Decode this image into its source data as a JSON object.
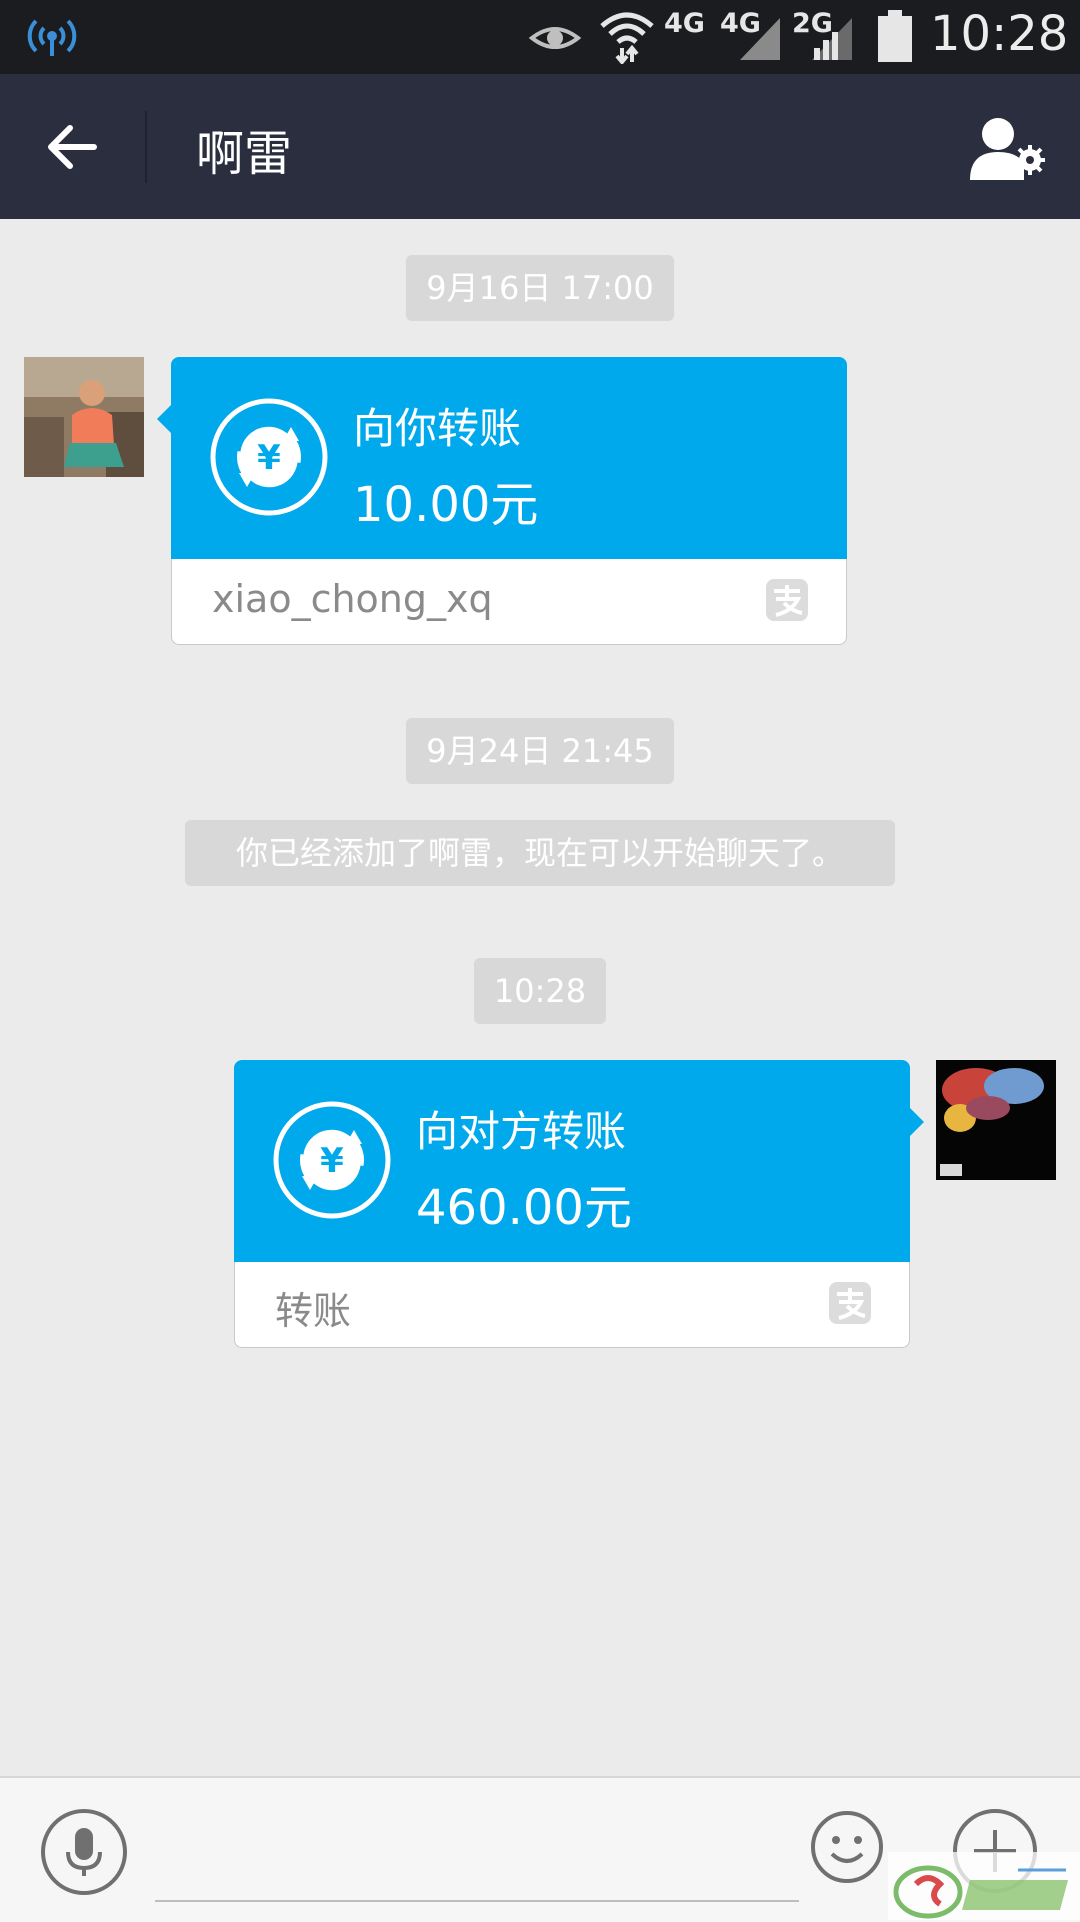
{
  "status_bar": {
    "network_labels": [
      "4G",
      "4G",
      "2G"
    ],
    "time": "10:28",
    "icons": [
      "hotspot-icon",
      "eye-icon",
      "wifi-icon",
      "signal-icon",
      "battery-icon"
    ]
  },
  "header": {
    "title": "啊雷",
    "icons": [
      "back-arrow-icon",
      "contact-settings-icon"
    ]
  },
  "messages": [
    {
      "type": "timestamp",
      "text": "9月16日 17:00"
    },
    {
      "type": "transfer",
      "direction": "incoming",
      "title": "向你转账",
      "amount": "10.00元",
      "sub": "xiao_chong_xq"
    },
    {
      "type": "timestamp",
      "text": "9月24日 21:45"
    },
    {
      "type": "system",
      "text": "你已经添加了啊雷，现在可以开始聊天了。"
    },
    {
      "type": "timestamp",
      "text": "10:28"
    },
    {
      "type": "transfer",
      "direction": "outgoing",
      "title": "向对方转账",
      "amount": "460.00元",
      "sub": "转账"
    }
  ],
  "input_bar": {
    "placeholder": "",
    "icons": [
      "microphone-icon",
      "emoji-icon",
      "plus-icon"
    ]
  },
  "colors": {
    "status_bar": "#1b1c1f",
    "header": "#2b2e3f",
    "background": "#ebebeb",
    "transfer_card": "#00a9eb",
    "timestamp_chip": "#d8d8d8"
  }
}
